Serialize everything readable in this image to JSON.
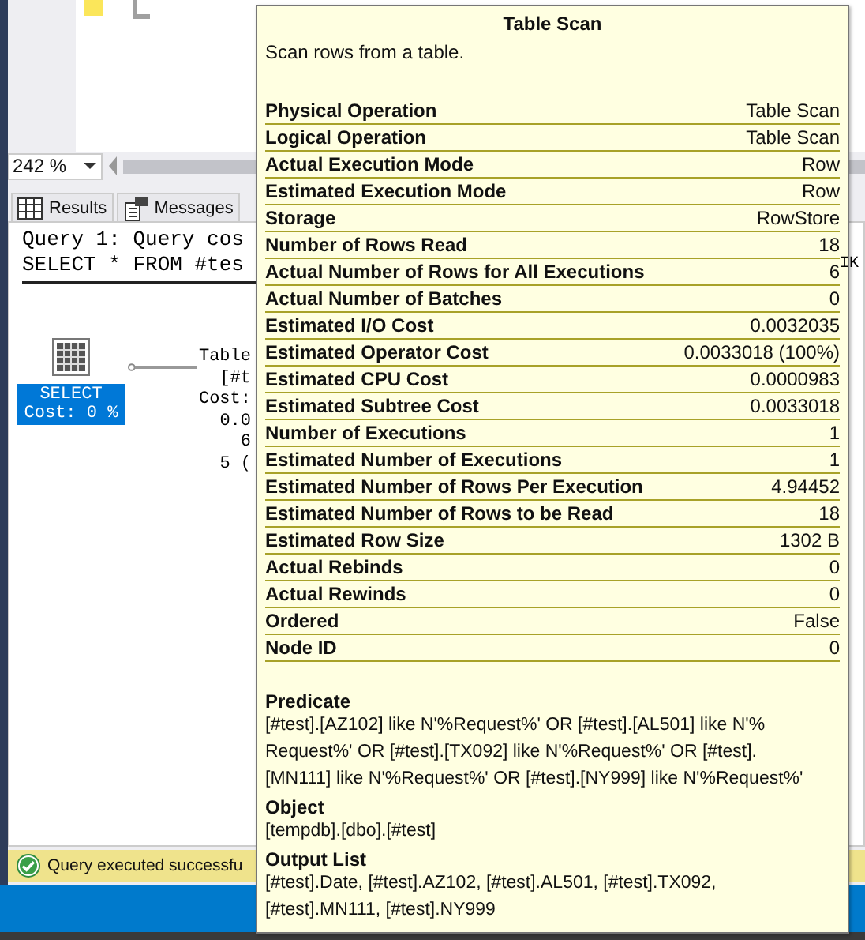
{
  "editor": {
    "zoom": "242 %"
  },
  "result_tabs": [
    {
      "label": "Results",
      "selected": false
    },
    {
      "label": "Messages",
      "selected": false
    }
  ],
  "query_header": [
    "Query 1: Query cos",
    "SELECT * FROM #tes"
  ],
  "plan": {
    "select_node": {
      "label": "SELECT",
      "cost": "Cost: 0 %",
      "selected": true
    },
    "scan_node_lines": [
      "Table",
      "[#t",
      "Cost:",
      "0.0",
      "6",
      "5 ("
    ],
    "right_fragment": "IK"
  },
  "status_bar": {
    "message": "Query executed successfu"
  },
  "tooltip": {
    "title": "Table Scan",
    "description": "Scan rows from a table.",
    "properties": [
      {
        "name": "Physical Operation",
        "value": "Table Scan"
      },
      {
        "name": "Logical Operation",
        "value": "Table Scan"
      },
      {
        "name": "Actual Execution Mode",
        "value": "Row"
      },
      {
        "name": "Estimated Execution Mode",
        "value": "Row"
      },
      {
        "name": "Storage",
        "value": "RowStore"
      },
      {
        "name": "Number of Rows Read",
        "value": "18"
      },
      {
        "name": "Actual Number of Rows for All Executions",
        "value": "6"
      },
      {
        "name": "Actual Number of Batches",
        "value": "0"
      },
      {
        "name": "Estimated I/O Cost",
        "value": "0.0032035"
      },
      {
        "name": "Estimated Operator Cost",
        "value": "0.0033018 (100%)"
      },
      {
        "name": "Estimated CPU Cost",
        "value": "0.0000983"
      },
      {
        "name": "Estimated Subtree Cost",
        "value": "0.0033018"
      },
      {
        "name": "Number of Executions",
        "value": "1"
      },
      {
        "name": "Estimated Number of Executions",
        "value": "1"
      },
      {
        "name": "Estimated Number of Rows Per Execution",
        "value": "4.94452"
      },
      {
        "name": "Estimated Number of Rows to be Read",
        "value": "18"
      },
      {
        "name": "Estimated Row Size",
        "value": "1302 B"
      },
      {
        "name": "Actual Rebinds",
        "value": "0"
      },
      {
        "name": "Actual Rewinds",
        "value": "0"
      },
      {
        "name": "Ordered",
        "value": "False"
      },
      {
        "name": "Node ID",
        "value": "0"
      }
    ],
    "sections": [
      {
        "heading": "Predicate",
        "lines": [
          "[#test].[AZ102] like N'%Request%' OR [#test].[AL501] like N'%",
          "Request%' OR [#test].[TX092] like N'%Request%' OR [#test].",
          "[MN111] like N'%Request%' OR [#test].[NY999] like N'%Request%'"
        ]
      },
      {
        "heading": "Object",
        "lines": [
          "[tempdb].[dbo].[#test]"
        ]
      },
      {
        "heading": "Output List",
        "lines": [
          "[#test].Date, [#test].AZ102, [#test].AL501, [#test].TX092,",
          "[#test].MN111, [#test].NY999"
        ]
      }
    ]
  }
}
